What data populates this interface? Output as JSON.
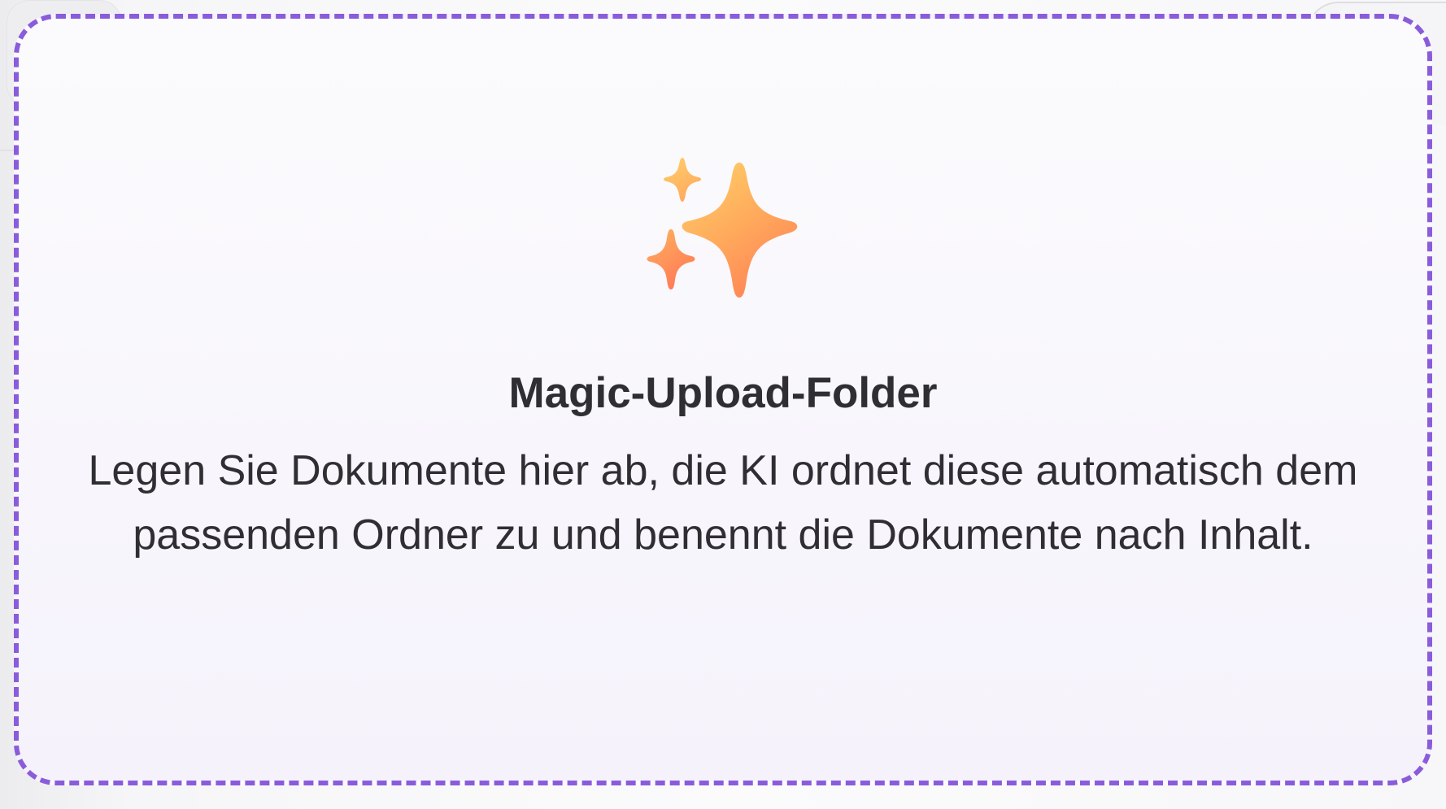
{
  "dropzone": {
    "icon": "sparkles-icon",
    "title": "Magic-Upload-Folder",
    "description": "Legen Sie Dokumente hier ab, die KI ordnet diese automatisch dem passenden Ordner zu und benennt die Dokumente nach Inhalt.",
    "border_color": "#8a5cdb",
    "icon_colors": [
      "#ffd166",
      "#ff8a5c"
    ]
  }
}
